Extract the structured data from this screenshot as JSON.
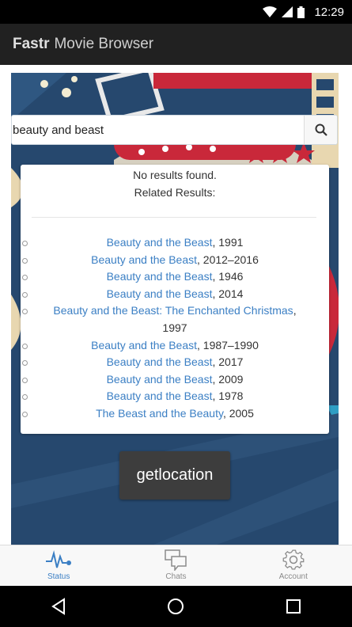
{
  "status_bar": {
    "time": "12:29"
  },
  "app_bar": {
    "brand": "Fastr",
    "subtitle": "Movie Browser"
  },
  "search": {
    "value": "beauty and beast",
    "icon": "search-icon"
  },
  "results": {
    "no_results": "No results found.",
    "related_heading": "Related Results:",
    "items": [
      {
        "title": "Beauty and the Beast",
        "year": ", 1991"
      },
      {
        "title": "Beauty and the Beast",
        "year": ", 2012–2016"
      },
      {
        "title": "Beauty and the Beast",
        "year": ", 1946"
      },
      {
        "title": "Beauty and the Beast",
        "year": ", 2014"
      },
      {
        "title": "Beauty and the Beast: The Enchanted Christmas",
        "year": ", 1997"
      },
      {
        "title": "Beauty and the Beast",
        "year": ", 1987–1990"
      },
      {
        "title": "Beauty and the Beast",
        "year": ", 2017"
      },
      {
        "title": "Beauty and the Beast",
        "year": ", 2009"
      },
      {
        "title": "Beauty and the Beast",
        "year": ", 1978"
      },
      {
        "title": "The Beast and the Beauty",
        "year": ", 2005"
      }
    ]
  },
  "getlocation_button": {
    "label": "getlocation"
  },
  "tabs": [
    {
      "label": "Status",
      "icon": "pulse-icon",
      "active": true
    },
    {
      "label": "Chats",
      "icon": "chat-bubbles-icon",
      "active": false
    },
    {
      "label": "Account",
      "icon": "gear-icon",
      "active": false
    }
  ],
  "colors": {
    "link": "#3b7fc4",
    "app_bar": "#212121",
    "poster_bg": "#26486e",
    "active_tab": "#3b7fc4"
  }
}
